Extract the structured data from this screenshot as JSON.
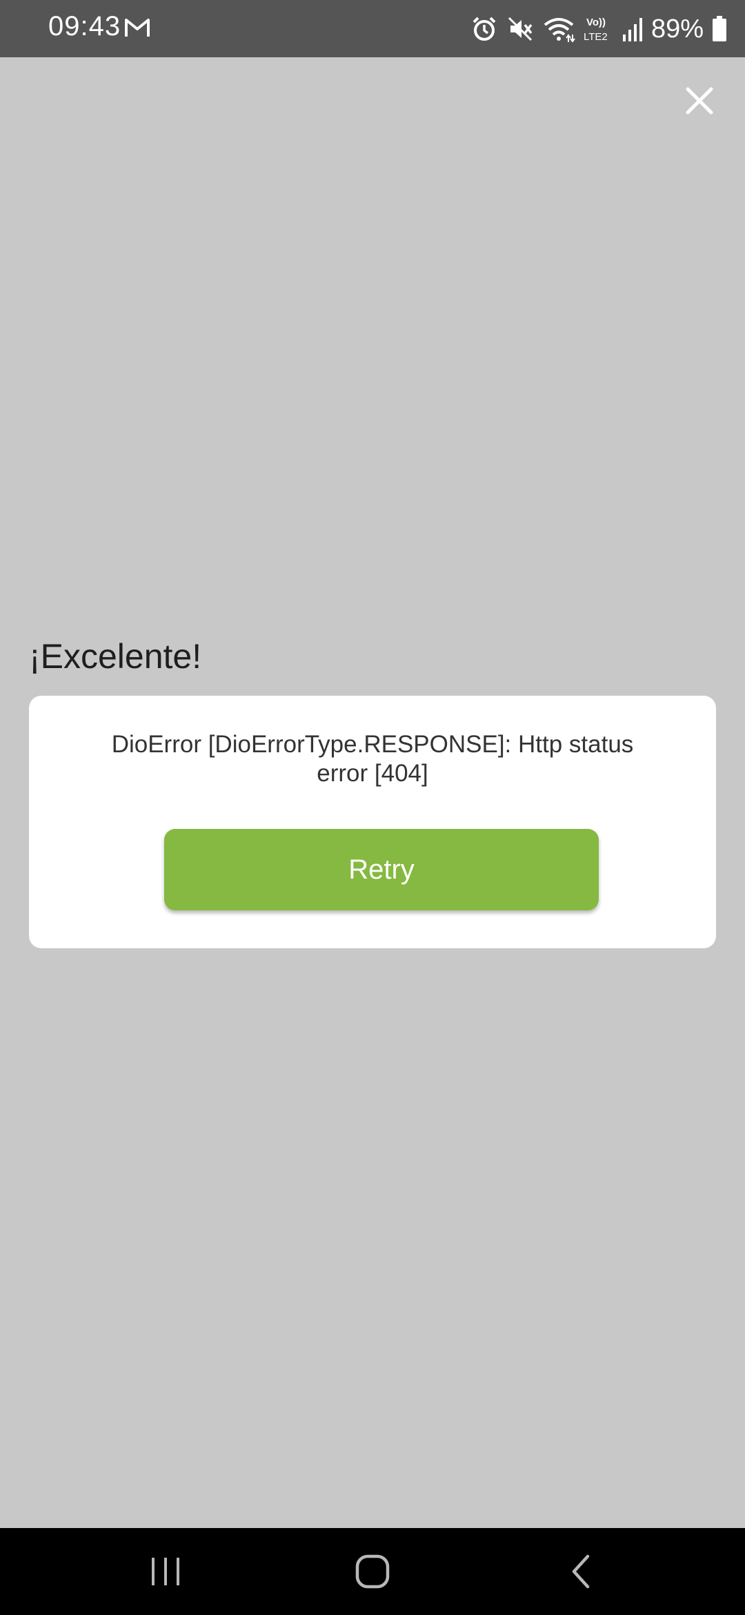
{
  "status_bar": {
    "time": "09:43",
    "battery_percent": "89%",
    "icons": [
      "gmail-icon",
      "alarm-icon",
      "mute-icon",
      "wifi-icon",
      "volte-lte2-icon",
      "signal-icon",
      "battery-icon"
    ]
  },
  "dialog": {
    "title": "¡Excelente!",
    "error_message": "DioError [DioErrorType.RESPONSE]: Http status error [404]",
    "retry_label": "Retry",
    "close_icon": "close-icon"
  },
  "colors": {
    "background": "#c8c8c8",
    "status_bar": "#555555",
    "accent_button": "#86b941",
    "nav_bar": "#000000"
  },
  "nav_bar": {
    "buttons": [
      "recents-icon",
      "home-icon",
      "back-icon"
    ]
  }
}
